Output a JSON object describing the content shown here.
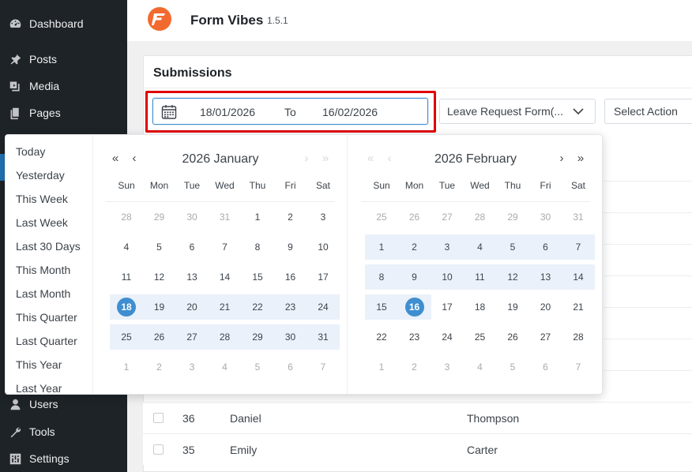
{
  "sidebar": {
    "items": [
      {
        "label": "Dashboard",
        "icon": "dashboard-icon"
      },
      {
        "label": "Posts",
        "icon": "pin-icon"
      },
      {
        "label": "Media",
        "icon": "media-icon"
      },
      {
        "label": "Pages",
        "icon": "pages-icon"
      },
      {
        "label": "Users",
        "icon": "users-icon"
      },
      {
        "label": "Tools",
        "icon": "tools-icon"
      },
      {
        "label": "Settings",
        "icon": "settings-icon"
      }
    ]
  },
  "header": {
    "title": "Form Vibes",
    "version": "1.5.1"
  },
  "main": {
    "title": "Submissions",
    "range": {
      "start": "18/01/2026",
      "separator": "To",
      "end": "16/02/2026"
    },
    "form_select": "Leave Request Form(...",
    "action_select": "Select Action"
  },
  "table": {
    "rows": [
      {
        "id": "36",
        "first": "Daniel",
        "last": "Thompson"
      },
      {
        "id": "35",
        "first": "Emily",
        "last": "Carter"
      }
    ]
  },
  "picker": {
    "presets": [
      "Today",
      "Yesterday",
      "This Week",
      "Last Week",
      "Last 30 Days",
      "This Month",
      "Last Month",
      "This Quarter",
      "Last Quarter",
      "This Year",
      "Last Year"
    ],
    "weekdays": [
      "Sun",
      "Mon",
      "Tue",
      "Wed",
      "Thu",
      "Fri",
      "Sat"
    ],
    "nav": {
      "prev_year": "«",
      "prev_month": "‹",
      "next_month": "›",
      "next_year": "»"
    },
    "left": {
      "heading": "2026 January",
      "weeks": [
        [
          "28",
          "29",
          "30",
          "31",
          "1",
          "2",
          "3"
        ],
        [
          "4",
          "5",
          "6",
          "7",
          "8",
          "9",
          "10"
        ],
        [
          "11",
          "12",
          "13",
          "14",
          "15",
          "16",
          "17"
        ],
        [
          "18",
          "19",
          "20",
          "21",
          "22",
          "23",
          "24"
        ],
        [
          "25",
          "26",
          "27",
          "28",
          "29",
          "30",
          "31"
        ],
        [
          "1",
          "2",
          "3",
          "4",
          "5",
          "6",
          "7"
        ]
      ]
    },
    "right": {
      "heading": "2026 February",
      "weeks": [
        [
          "25",
          "26",
          "27",
          "28",
          "29",
          "30",
          "31"
        ],
        [
          "1",
          "2",
          "3",
          "4",
          "5",
          "6",
          "7"
        ],
        [
          "8",
          "9",
          "10",
          "11",
          "12",
          "13",
          "14"
        ],
        [
          "15",
          "16",
          "17",
          "18",
          "19",
          "20",
          "21"
        ],
        [
          "22",
          "23",
          "24",
          "25",
          "26",
          "27",
          "28"
        ],
        [
          "1",
          "2",
          "3",
          "4",
          "5",
          "6",
          "7"
        ]
      ]
    },
    "colors": {
      "accent": "#3e8ed0",
      "range": "#eaf1fa",
      "highlight": "#e00000"
    }
  }
}
